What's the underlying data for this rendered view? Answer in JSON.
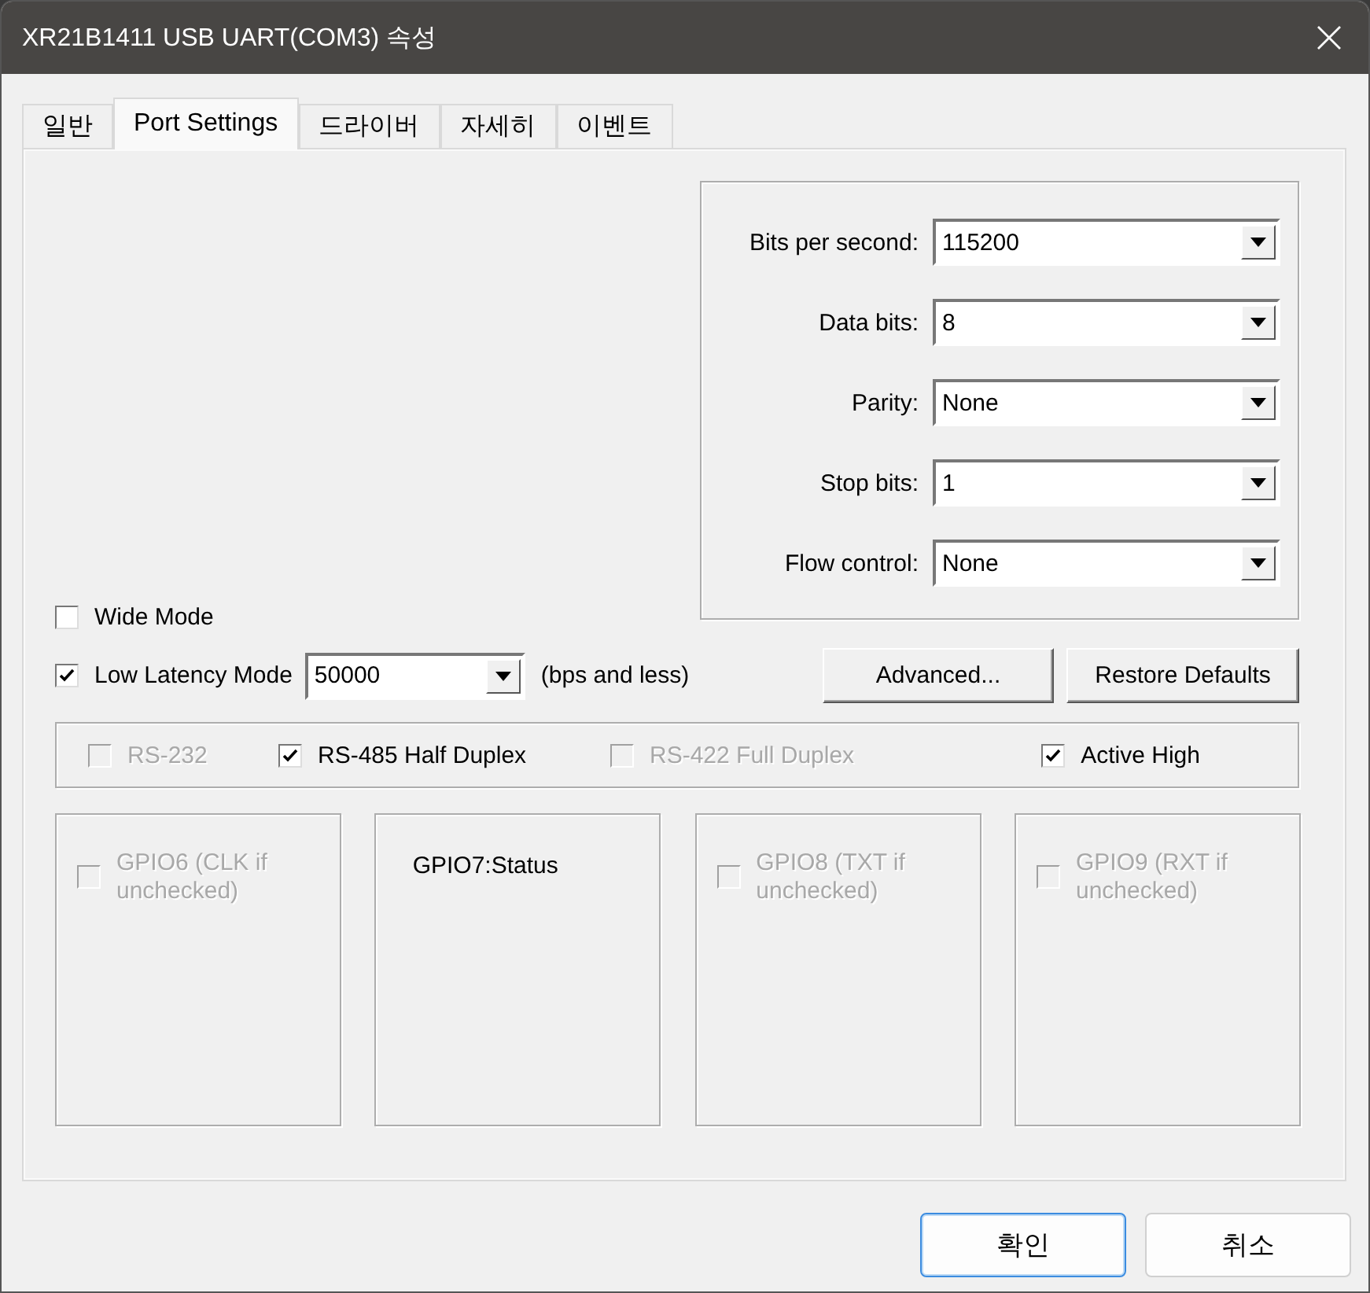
{
  "window": {
    "title": "XR21B1411 USB UART(COM3) 속성"
  },
  "tabs": [
    {
      "label": "일반",
      "selected": false
    },
    {
      "label": "Port Settings",
      "selected": true
    },
    {
      "label": "드라이버",
      "selected": false
    },
    {
      "label": "자세히",
      "selected": false
    },
    {
      "label": "이벤트",
      "selected": false
    }
  ],
  "serial_settings": [
    {
      "label": "Bits per second:",
      "value": "115200"
    },
    {
      "label": "Data bits:",
      "value": "8"
    },
    {
      "label": "Parity:",
      "value": "None"
    },
    {
      "label": "Stop bits:",
      "value": "1"
    },
    {
      "label": "Flow control:",
      "value": "None"
    }
  ],
  "wide_mode": {
    "label": "Wide Mode",
    "checked": false
  },
  "low_latency": {
    "label": "Low Latency Mode",
    "checked": true,
    "value": "50000",
    "suffix": "(bps and less)"
  },
  "buttons": [
    "Advanced...",
    "Restore Defaults"
  ],
  "modes": [
    {
      "label": "RS-232",
      "checked": false,
      "disabled": true
    },
    {
      "label": "RS-485 Half Duplex",
      "checked": true,
      "disabled": false
    },
    {
      "label": "RS-422 Full Duplex",
      "checked": false,
      "disabled": true
    },
    {
      "label": "Active High",
      "checked": true,
      "disabled": false
    }
  ],
  "gpio": [
    {
      "kind": "checkbox",
      "label": "GPIO6 (CLK if unchecked)",
      "checked": false,
      "disabled": true
    },
    {
      "kind": "text",
      "label": "GPIO7:Status"
    },
    {
      "kind": "checkbox",
      "label": "GPIO8 (TXT if unchecked)",
      "checked": false,
      "disabled": true
    },
    {
      "kind": "checkbox",
      "label": "GPIO9 (RXT if unchecked)",
      "checked": false,
      "disabled": true
    }
  ],
  "footer_buttons": [
    {
      "label": "확인",
      "default": true
    },
    {
      "label": "취소",
      "default": false
    }
  ]
}
